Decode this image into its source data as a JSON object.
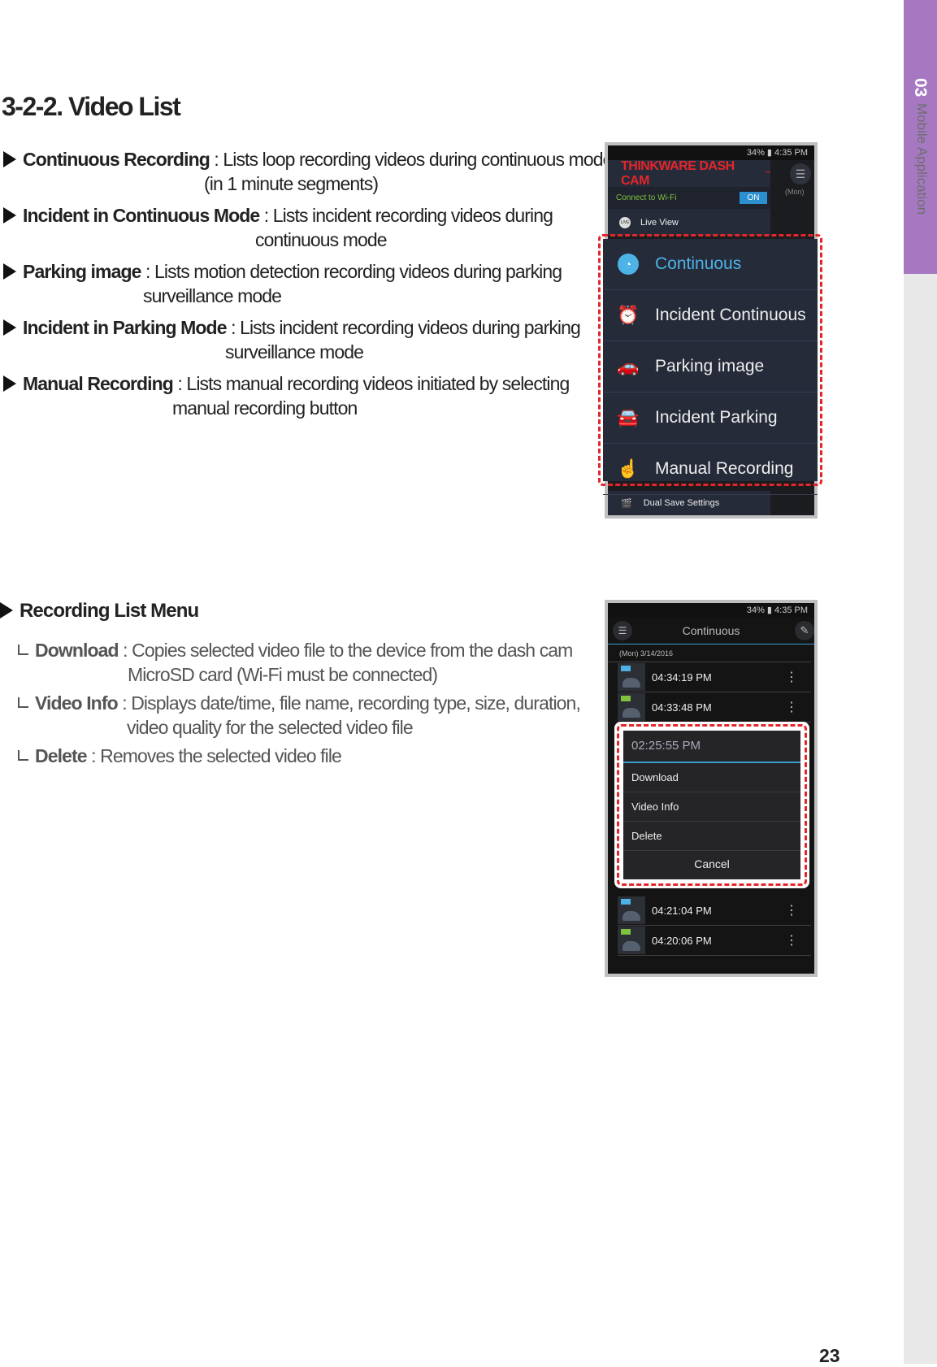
{
  "side_tab": {
    "number": "03",
    "label": "Mobile Application",
    "color": "#a678c2"
  },
  "title": "3-2-2. Video List",
  "items": [
    {
      "label": "Continuous Recording",
      "desc1": " : Lists loop recording videos during continuous mode",
      "desc2": "(in 1 minute segments)"
    },
    {
      "label": "Incident in Continuous Mode",
      "desc1": " : Lists incident recording videos during",
      "desc2": "continuous mode"
    },
    {
      "label": "Parking image",
      "desc1": " : Lists motion detection recording videos during parking",
      "desc2": "surveillance mode"
    },
    {
      "label": "Incident in Parking Mode",
      "desc1": " : Lists incident recording videos during parking",
      "desc2": "surveillance mode"
    },
    {
      "label": "Manual Recording",
      "desc1": " : Lists manual recording videos initiated by selecting",
      "desc2": "manual recording button"
    }
  ],
  "list_menu": {
    "heading": "Recording List Menu",
    "subs": [
      {
        "label": "Download",
        "desc1": " : Copies selected video file to the device from the dash cam",
        "desc2": "MicroSD card (Wi-Fi must be connected)"
      },
      {
        "label": "Video Info",
        "desc1": " : Displays date/time, file name, recording type, size, duration,",
        "desc2": "video quality for the selected video file"
      },
      {
        "label": "Delete",
        "desc1": " : Removes the selected video file"
      }
    ]
  },
  "phone1": {
    "status": "34% ▮ 4:35 PM",
    "brand": "THINKWARE DASH CAM",
    "brand_tm": "™",
    "wifi_label": "Connect to Wi-Fi",
    "wifi_toggle": "ON",
    "date_peek": "(Mon)",
    "live_view": "Live View",
    "menu": [
      {
        "label": "Continuous",
        "icon": "clock-icon",
        "active": true
      },
      {
        "label": "Incident Continuous",
        "icon": "incident-clock-icon"
      },
      {
        "label": "Parking image",
        "icon": "parking-car-icon"
      },
      {
        "label": "Incident Parking",
        "icon": "incident-car-icon"
      },
      {
        "label": "Manual Recording",
        "icon": "hand-pointer-icon"
      }
    ],
    "dual_save": "Dual Save Settings"
  },
  "phone2": {
    "status": "34% ▮ 4:35 PM",
    "header": "Continuous",
    "date": "(Mon) 3/14/2016",
    "rows_top": [
      {
        "time": "04:34:19 PM",
        "type": "continuous"
      },
      {
        "time": "04:33:48 PM",
        "type": "manual"
      }
    ],
    "dialog": {
      "title": "02:25:55 PM",
      "options": [
        "Download",
        "Video Info",
        "Delete"
      ],
      "cancel": "Cancel"
    },
    "rows_bottom": [
      {
        "time": "04:21:04 PM",
        "type": "continuous"
      },
      {
        "time": "04:20:06 PM",
        "type": "manual"
      }
    ]
  },
  "colors": {
    "highlight": "#e3262a",
    "accent_blue": "#4db3e6",
    "brand_red": "#e3262a"
  },
  "page_number": "23"
}
